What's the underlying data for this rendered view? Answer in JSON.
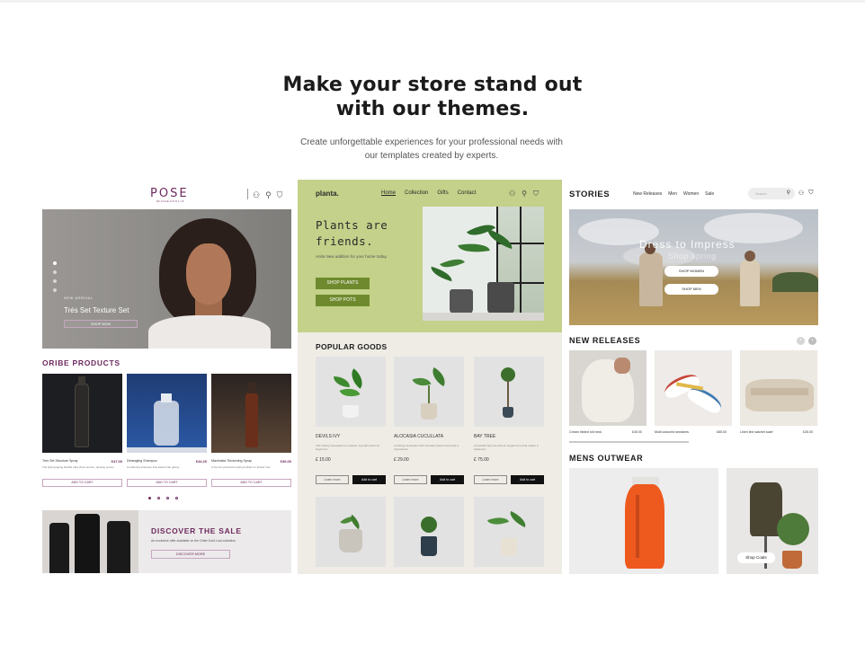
{
  "hero": {
    "title_line1": "Make your store stand out",
    "title_line2": "with our themes.",
    "subtitle_line1": "Create unforgettable experiences for your professional needs with",
    "subtitle_line2": "our templates created by experts."
  },
  "pose": {
    "logo": "POSE",
    "logo_sub": "MINNEAPOLIS",
    "icons": [
      "user-icon",
      "search-icon",
      "cart-icon"
    ],
    "hero": {
      "eyebrow": "NEW ARRIVAL",
      "title": "Trés Set Texture Set",
      "button": "SHOP NOW"
    },
    "section_title": "ORIBE PRODUCTS",
    "products": [
      {
        "name": "Tres Set Structure Spray",
        "price": "€47.00",
        "desc": "The light-gripping flexible ultra shine texture, densely serves",
        "button": "ADD TO CART"
      },
      {
        "name": "Detangling Shampoo",
        "price": "€44.20",
        "desc": "A softening shampoo that leaves hair glossy",
        "button": "ADD TO CART"
      },
      {
        "name": "Maximista Thickening Spray",
        "price": "€36.00",
        "desc": "A thermo-protectant styling builder for thicker hair",
        "button": "ADD TO CART"
      }
    ],
    "sale": {
      "title": "DISCOVER THE SALE",
      "desc": "An exclusive offer available on the Oribe Gold Lust collection",
      "button": "DISCOVER MORE"
    }
  },
  "planta": {
    "logo": "planta.",
    "nav": [
      "Home",
      "Collection",
      "Gifts",
      "Contact"
    ],
    "hero": {
      "title_line1": "Plants are",
      "title_line2": "friends.",
      "desc": "Anita New addition for your home today.",
      "button1": "SHOP PLANTS",
      "button2": "SHOP POTS"
    },
    "section_title": "POPULAR GOODS",
    "goods": [
      {
        "name": "DEVILS IVY",
        "desc": "This trailing houseplant is a classic. A perfect plant for beginners.",
        "price": "£ 15.00",
        "learn": "Learn more",
        "add": "Add to cart"
      },
      {
        "name": "ALOCASIA CUCULLATA",
        "desc": "A striking houseplant with dramatic leaves that lends a tropical feel.",
        "price": "£ 29.00",
        "learn": "Learn more",
        "add": "Add to cart"
      },
      {
        "name": "BAY TREE",
        "desc": "A beautiful bay tree with an elegant form that makes a statement.",
        "price": "£ 75.00",
        "learn": "Learn more",
        "add": "Add to cart"
      }
    ]
  },
  "stories": {
    "logo": "STORIES",
    "nav": [
      "New Releases",
      "Men",
      "Women",
      "Sale"
    ],
    "search_placeholder": "Search",
    "hero": {
      "title": "Dress to Impress",
      "subtitle": "Shop spring",
      "button1": "SHOP WOMEN",
      "button2": "SHOP MEN"
    },
    "new_releases_title": "NEW RELEASES",
    "new_releases": [
      {
        "name": "Cream ribbed roll neck",
        "price": "£40.00"
      },
      {
        "name": "Multi coloured sneakers",
        "price": "£85.00"
      },
      {
        "name": "Linen line satchel scarf",
        "price": "£35.00"
      }
    ],
    "mens_title": "MENS OUTWEAR",
    "shop_coats": "Shop Coats"
  }
}
